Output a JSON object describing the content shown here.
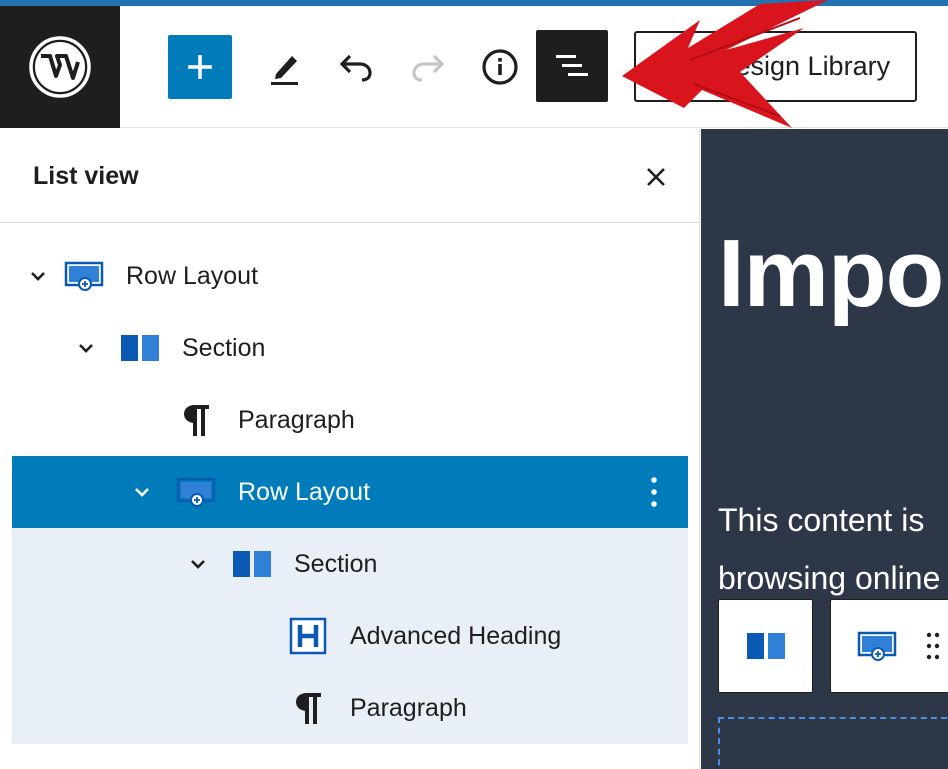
{
  "toolbar": {
    "logo_icon": "wordpress-logo-icon",
    "add_icon": "plus-icon",
    "edit_icon": "pencil-icon",
    "undo_icon": "undo-icon",
    "redo_icon": "redo-icon",
    "info_icon": "info-icon",
    "list_view_icon": "list-view-icon",
    "design_library_label": "Design Library",
    "accent": "#007cba"
  },
  "list_view": {
    "title": "List view",
    "close_icon": "close-icon",
    "items": [
      {
        "label": "Row Layout",
        "icon": "row-layout-icon",
        "level": 1,
        "expanded": true,
        "selected": false
      },
      {
        "label": "Section",
        "icon": "section-icon",
        "level": 2,
        "expanded": true,
        "selected": false
      },
      {
        "label": "Paragraph",
        "icon": "paragraph-icon",
        "level": 3,
        "selected": false
      },
      {
        "label": "Row Layout",
        "icon": "row-layout-icon",
        "level": 3,
        "expanded": true,
        "selected": true
      },
      {
        "label": "Section",
        "icon": "section-icon",
        "level": 4,
        "expanded": true,
        "selected": false
      },
      {
        "label": "Advanced Heading",
        "icon": "advanced-heading-icon",
        "level": 5,
        "selected": false
      },
      {
        "label": "Paragraph",
        "icon": "paragraph-icon",
        "level": 5,
        "selected": false
      }
    ],
    "selected_color": "#007cba"
  },
  "preview": {
    "heading": "Impo",
    "text_line1": "This content is",
    "text_line2": "browsing online",
    "background": "#2e3748"
  }
}
